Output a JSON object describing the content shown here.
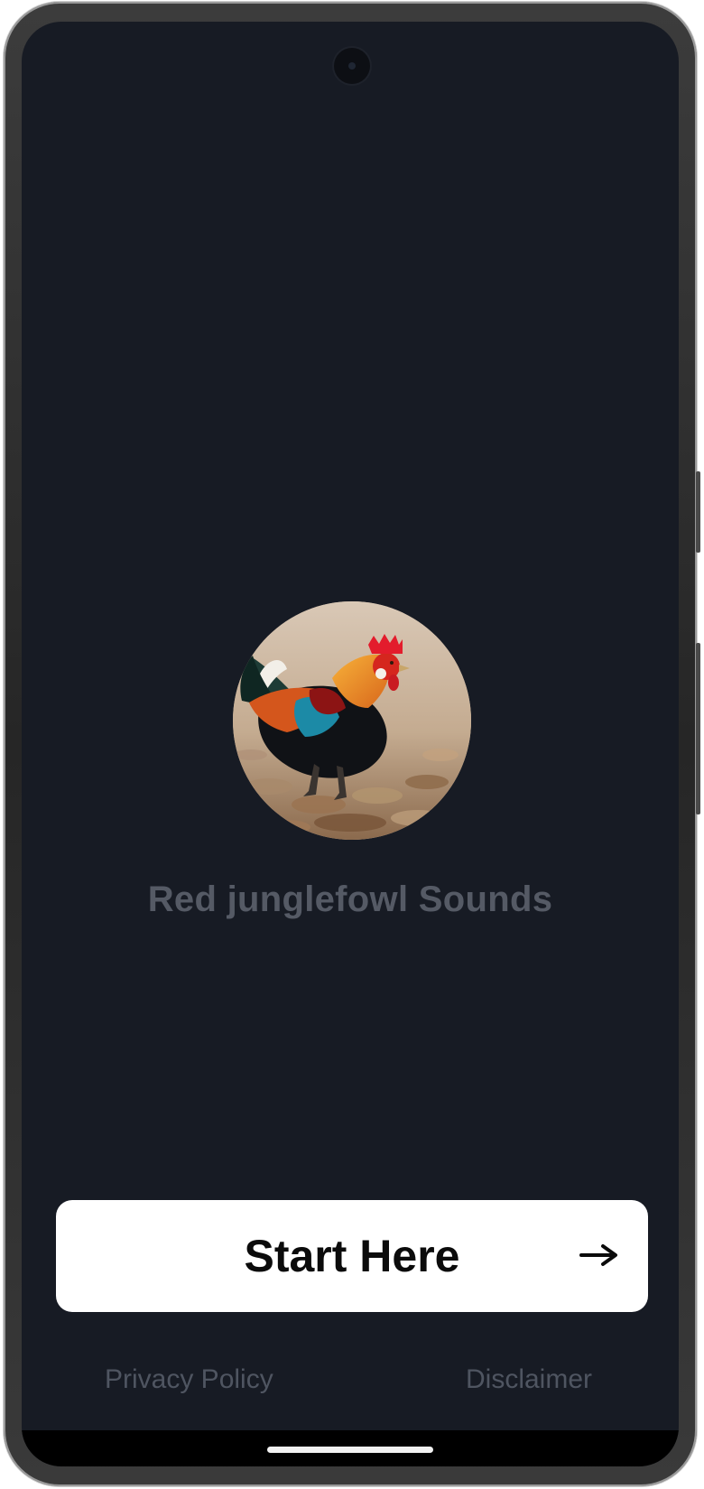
{
  "app": {
    "title": "Red junglefowl Sounds",
    "logo_icon": "red-junglefowl-rooster-photo"
  },
  "actions": {
    "start_label": "Start Here",
    "start_icon": "arrow-right-icon"
  },
  "footer": {
    "privacy_label": "Privacy Policy",
    "disclaimer_label": "Disclaimer"
  },
  "theme": {
    "background": "#171b24",
    "button_background": "#ffffff",
    "title_color": "#555a65",
    "link_color": "#4f5561"
  }
}
